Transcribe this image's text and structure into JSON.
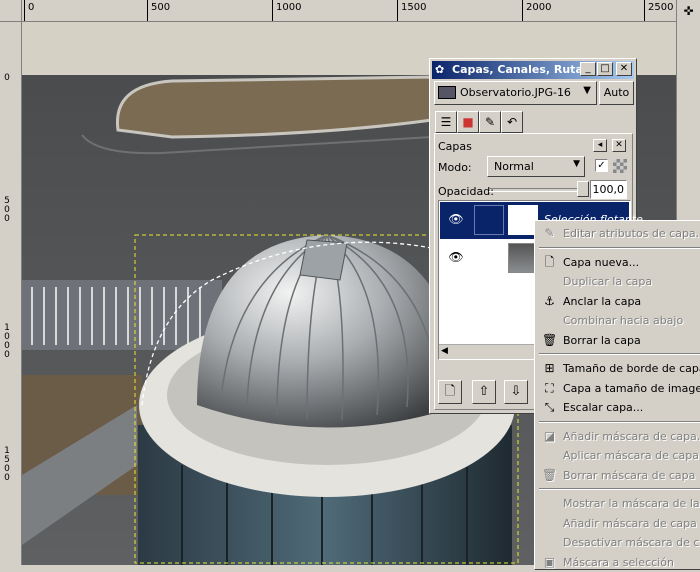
{
  "rulers": {
    "h_labels": [
      "0",
      "500",
      "1000",
      "1500",
      "2000",
      "2500"
    ],
    "v_labels": [
      "0",
      "500",
      "1000",
      "1500"
    ]
  },
  "navigate_icon": "navigate-icon",
  "canvas": {
    "selection": "floating-selection-marching-ants"
  },
  "dialog": {
    "title": "Capas, Canales, Ruta...",
    "image_select": "Observatorio.JPG-16",
    "auto_label": "Auto",
    "tabs": [
      "layers-tab",
      "channels-tab",
      "paths-tab",
      "undo-tab"
    ],
    "section_title": "Capas",
    "mode_label": "Modo:",
    "mode_value": "Normal",
    "opacity_label": "Opacidad:",
    "opacity_value": "100,0",
    "opacity_fraction": 1.0,
    "layers": [
      {
        "name": "Selección flotante",
        "selected": true
      },
      {
        "name": "",
        "selected": false
      }
    ],
    "buttons": [
      "new-layer",
      "raise-layer",
      "lower-layer"
    ]
  },
  "menu": {
    "items": [
      {
        "label": "Editar atributos de capa...",
        "enabled": false,
        "icon": "edit-icon"
      },
      {
        "sep": true
      },
      {
        "label": "Capa nueva...",
        "enabled": true,
        "icon": "new-page-icon"
      },
      {
        "label": "Duplicar la capa",
        "enabled": false,
        "icon": ""
      },
      {
        "label": "Anclar la capa",
        "enabled": true,
        "icon": "anchor-icon"
      },
      {
        "label": "Combinar hacia abajo",
        "enabled": false,
        "icon": ""
      },
      {
        "label": "Borrar la capa",
        "enabled": true,
        "icon": "trash-icon"
      },
      {
        "sep": true
      },
      {
        "label": "Tamaño de borde de capa...",
        "enabled": true,
        "icon": "resize-icon"
      },
      {
        "label": "Capa a tamaño de imagen",
        "enabled": true,
        "icon": "fit-icon"
      },
      {
        "label": "Escalar capa...",
        "enabled": true,
        "icon": "scale-icon"
      },
      {
        "sep": true
      },
      {
        "label": "Añadir máscara de capa...",
        "enabled": false,
        "icon": "mask-icon"
      },
      {
        "label": "Aplicar máscara de capa",
        "enabled": false,
        "icon": ""
      },
      {
        "label": "Borrar máscara de capa",
        "enabled": false,
        "icon": "trash-icon"
      },
      {
        "sep": true
      },
      {
        "label": "Mostrar la máscara de la capa",
        "enabled": false,
        "icon": ""
      },
      {
        "label": "Añadir máscara de capa",
        "enabled": false,
        "icon": ""
      },
      {
        "label": "Desactivar máscara de capa",
        "enabled": false,
        "icon": ""
      },
      {
        "label": "Máscara a selección",
        "enabled": false,
        "icon": "mask-selection-icon"
      }
    ]
  }
}
